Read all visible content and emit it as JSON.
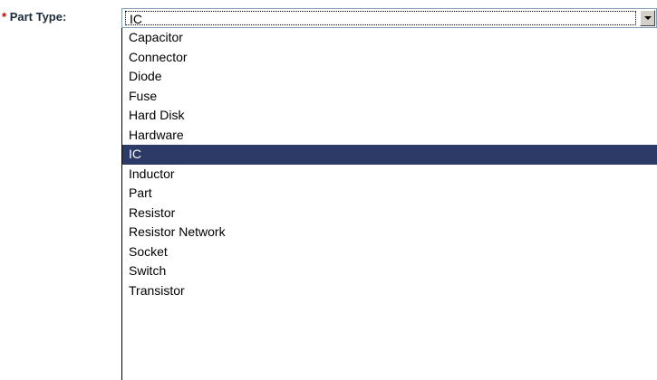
{
  "field": {
    "required_mark": "*",
    "label": "Part Type:"
  },
  "select": {
    "value": "IC",
    "arrow_icon": "chevron-down-icon"
  },
  "dropdown": {
    "selected_index": 6,
    "selected_color": "#2b3a66",
    "options": [
      "Capacitor",
      "Connector",
      "Diode",
      "Fuse",
      "Hard Disk",
      "Hardware",
      "IC",
      "Inductor",
      "Part",
      "Resistor",
      "Resistor Network",
      "Socket",
      "Switch",
      "Transistor"
    ]
  }
}
